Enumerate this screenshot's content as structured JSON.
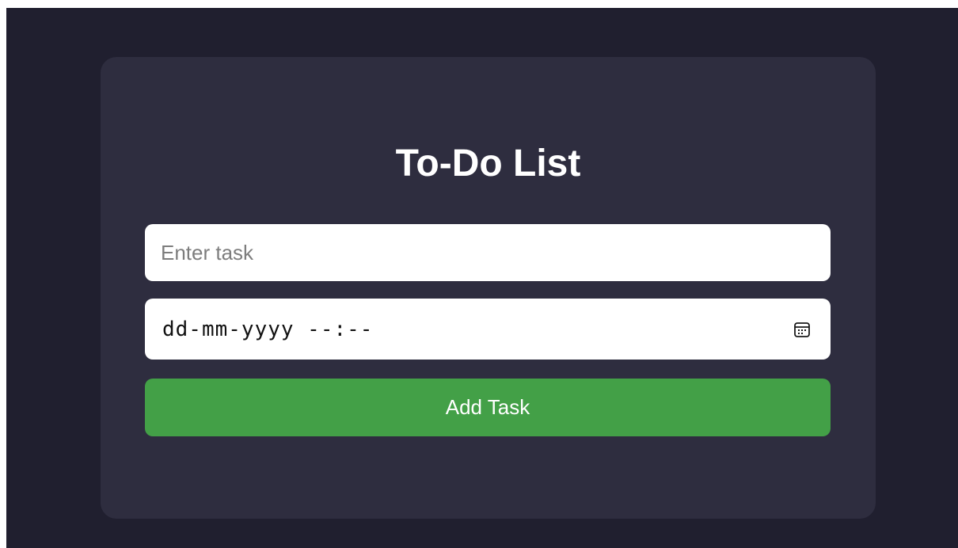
{
  "app": {
    "title": "To-Do List"
  },
  "form": {
    "task_input": {
      "value": "",
      "placeholder": "Enter task"
    },
    "datetime_input": {
      "display": "dd-mm-yyyy --:--",
      "icon": "calendar-icon"
    },
    "add_button_label": "Add Task"
  },
  "colors": {
    "page_background": "#201f2f",
    "card_background": "#2e2d3f",
    "accent_green": "#43a047",
    "title_text": "#ffffff",
    "input_background": "#ffffff",
    "placeholder_text": "#7d7d7d"
  }
}
